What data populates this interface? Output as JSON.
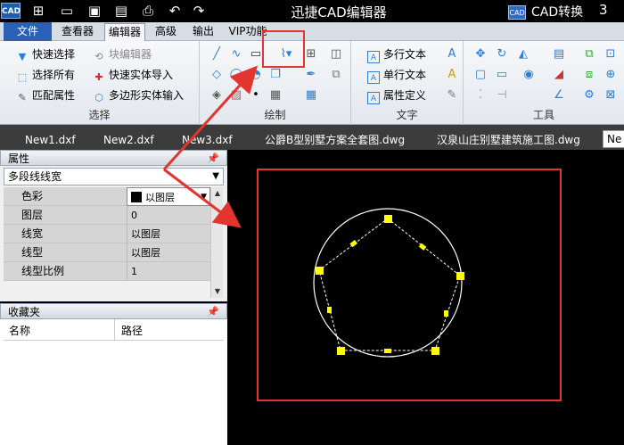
{
  "app": {
    "title": "迅捷CAD编辑器",
    "logo_text": "CAD",
    "cad_convert_label": "CAD转换",
    "cad_convert_icon_text": "CAD",
    "right_corner_text": "3"
  },
  "menu": {
    "tabs": [
      "文件",
      "查看器",
      "编辑器",
      "高级",
      "输出",
      "VIP功能"
    ],
    "active": "编辑器"
  },
  "ribbon": {
    "select_group": {
      "label": "选择",
      "items": [
        "快速选择",
        "块编辑器",
        "选择所有",
        "快速实体导入",
        "匹配属性",
        "多边形实体输入"
      ]
    },
    "draw_group": {
      "label": "绘制"
    },
    "text_group": {
      "label": "文字",
      "items": [
        "多行文本",
        "单行文本",
        "属性定义"
      ]
    },
    "tools_group": {
      "label": "工具"
    }
  },
  "doc_tabs": [
    "New1.dxf",
    "New2.dxf",
    "New3.dxf",
    "公爵B型别墅方案全套图.dwg",
    "汉泉山庄别墅建筑施工图.dwg",
    "Ne"
  ],
  "properties_panel": {
    "title": "属性",
    "pin": "ㅁ",
    "selected_type": "多段线线宽",
    "rows": [
      {
        "key": "色彩",
        "value": "以图层"
      },
      {
        "key": "图层",
        "value": "0"
      },
      {
        "key": "线宽",
        "value": "以图层"
      },
      {
        "key": "线型",
        "value": "以图层"
      },
      {
        "key": "线型比例",
        "value": "1"
      }
    ]
  },
  "favorites_panel": {
    "title": "收藏夹",
    "columns": [
      "名称",
      "路径"
    ]
  },
  "colors": {
    "accent": "#2b60b5",
    "highlight_red": "#e3342f",
    "grip_yellow": "#ffff00"
  }
}
